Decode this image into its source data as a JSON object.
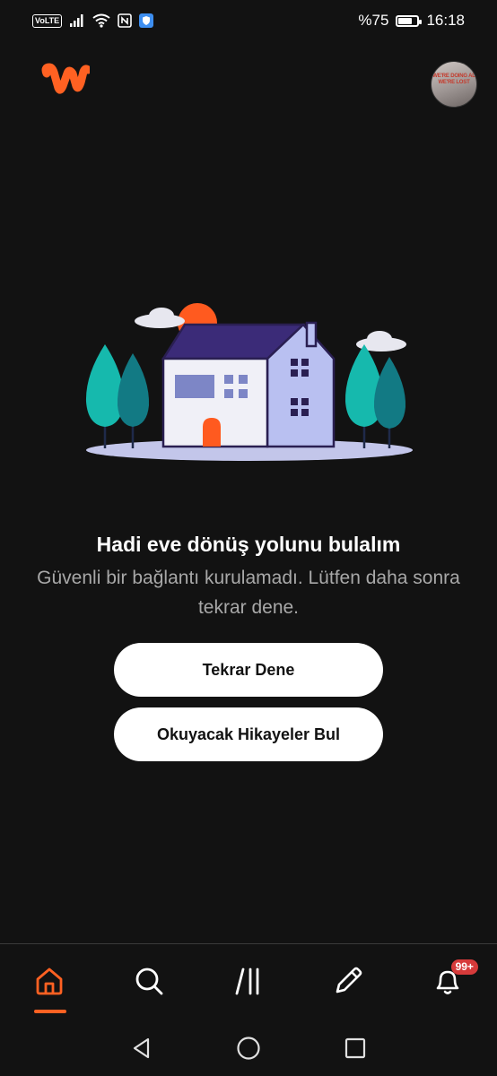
{
  "status_bar": {
    "network_badge": "VoLTE",
    "battery_percent": "%75",
    "battery_level": 0.75,
    "time": "16:18",
    "icons": [
      "signal-icon",
      "wifi-icon",
      "nfc-icon",
      "shield-icon",
      "battery-icon"
    ]
  },
  "header": {
    "logo_icon": "wattpad-logo-icon",
    "avatar_text": "WE'RE DOING AL\nWE'RE LOST",
    "colors": {
      "brand": "#ff6122"
    }
  },
  "error": {
    "title": "Hadi eve dönüş yolunu bulalım",
    "message": "Güvenli bir bağlantı kurulamadı. Lütfen daha sonra tekrar dene.",
    "retry_label": "Tekrar Dene",
    "find_stories_label": "Okuyacak Hikayeler Bul"
  },
  "bottom_nav": {
    "items": [
      {
        "name": "home",
        "icon": "home-icon",
        "active": true
      },
      {
        "name": "search",
        "icon": "search-icon",
        "active": false
      },
      {
        "name": "library",
        "icon": "library-icon",
        "active": false
      },
      {
        "name": "write",
        "icon": "pencil-icon",
        "active": false
      },
      {
        "name": "notifications",
        "icon": "bell-icon",
        "active": false
      }
    ],
    "notification_badge": "99+",
    "colors": {
      "active": "#ff6122",
      "badge": "#d63a3a"
    }
  },
  "system_nav": {
    "icons": [
      "back-icon",
      "home-circle-icon",
      "recents-icon"
    ]
  }
}
